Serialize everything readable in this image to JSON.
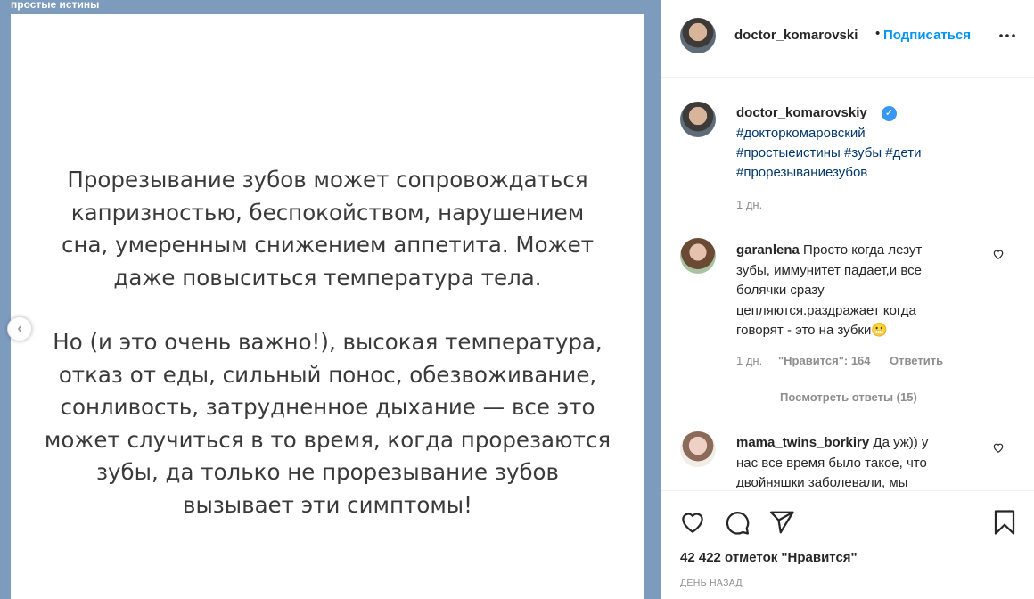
{
  "media": {
    "label": "простые истины",
    "paragraph1": [
      "Прорезывание зубов может сопровождаться",
      "капризностью, беспокойством, нарушением",
      "сна, умеренным снижением аппетита. Может",
      "даже повыситься температура тела."
    ],
    "paragraph2": [
      "Но (и это очень важно!), высокая температура,",
      "отказ от еды, сильный понос, обезвоживание,",
      "сонливость, затрудненное дыхание — все это",
      "может случиться в то время, когда прорезаются",
      "зубы, да только не прорезывание зубов",
      "вызывает эти симптомы!"
    ],
    "prev_icon": "chevron-left-icon"
  },
  "header": {
    "username": "doctor_komarovski",
    "dot": "•",
    "follow_label": "Подписаться",
    "more_label": "•••"
  },
  "caption": {
    "username": "doctor_komarovskiy",
    "verified_icon": "verified-badge-icon",
    "tags_line1": "#докторкомаровский",
    "tags_line2": "#простыеистины #зубы #дети",
    "tags_line3": "#прорезываниезубов",
    "time": "1 дн."
  },
  "comments": [
    {
      "username": "garanlena",
      "text_lines": [
        "Просто когда лезут",
        "зубы, иммунитет падает,и все",
        "болячки сразу",
        "цепляются.раздражает когда",
        "говорят - это на зубки😬"
      ],
      "time": "1 дн.",
      "likes": "\"Нравится\": 164",
      "reply_label": "Ответить",
      "view_replies": "Посмотреть ответы (15)"
    },
    {
      "username": "mama_twins_borkiry",
      "text_lines": [
        "Да уж)) у",
        "нас все время было такое, что",
        "двойняшки заболевали, мы"
      ]
    }
  ],
  "actions": {
    "like_icon": "heart-icon",
    "comment_icon": "comment-icon",
    "share_icon": "share-icon",
    "save_icon": "bookmark-icon",
    "likes_count": "42 422 отметок \"Нравится\"",
    "date": "ДЕНЬ НАЗАД"
  }
}
